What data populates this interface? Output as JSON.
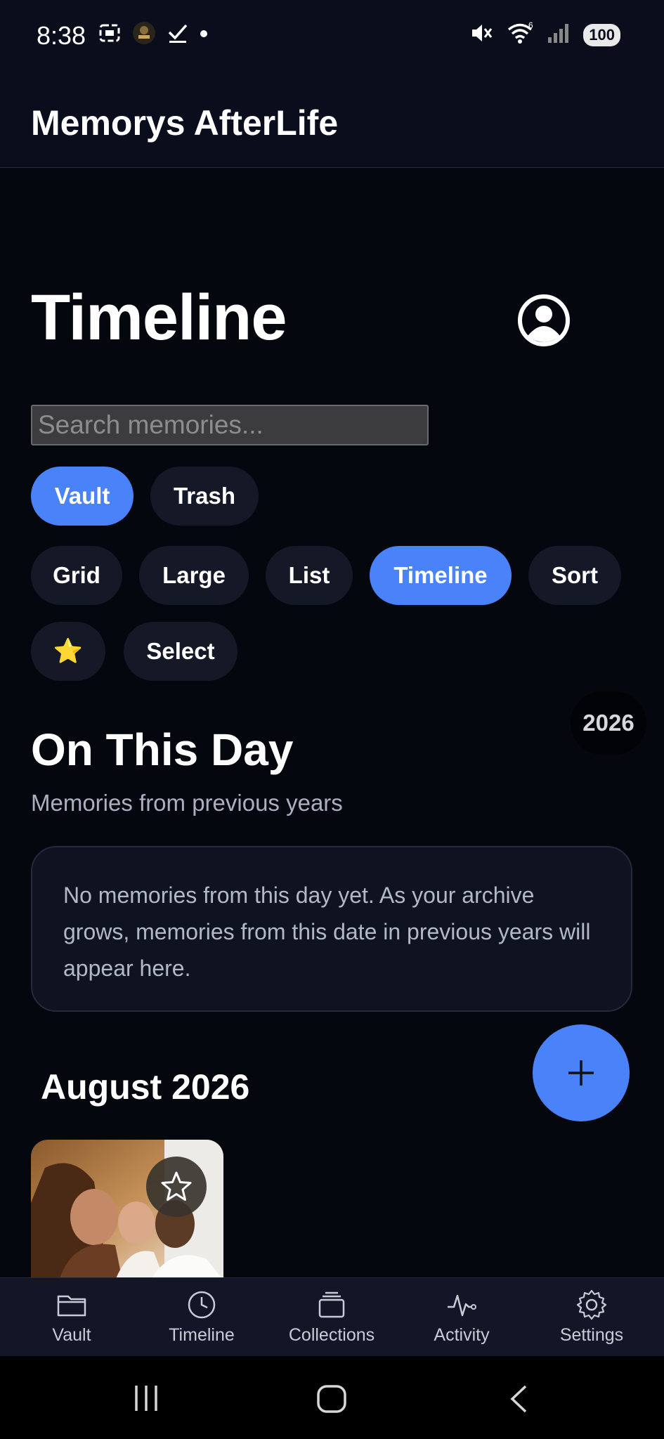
{
  "status_bar": {
    "time": "8:38",
    "battery": "100",
    "left_icons": [
      "screenshot-icon",
      "app-avatar-icon",
      "check-icon",
      "dot-icon"
    ],
    "right_icons": [
      "mute-icon",
      "wifi-icon",
      "signal-icon",
      "battery-icon"
    ],
    "wifi_badge": "6"
  },
  "app": {
    "title": "Memorys AfterLife"
  },
  "page": {
    "title": "Timeline",
    "search_placeholder": "Search memories...",
    "filter_tabs": [
      {
        "label": "Vault",
        "active": true
      },
      {
        "label": "Trash",
        "active": false
      }
    ],
    "view_modes": [
      {
        "label": "Grid",
        "active": false
      },
      {
        "label": "Large",
        "active": false
      },
      {
        "label": "List",
        "active": false
      },
      {
        "label": "Timeline",
        "active": true
      },
      {
        "label": "Sort",
        "active": false
      }
    ],
    "favorites_label": "⭐",
    "select_label": "Select",
    "year_badge": "2026"
  },
  "on_this_day": {
    "title": "On This Day",
    "subtitle": "Memories from previous years",
    "empty_message": "No memories from this day yet. As your archive grows, memories from this date in previous years will appear here."
  },
  "month_section": {
    "label": "August 2026"
  },
  "fab": {
    "icon": "plus-icon"
  },
  "bottom_nav": [
    {
      "label": "Vault",
      "icon": "folder-icon"
    },
    {
      "label": "Timeline",
      "icon": "clock-icon"
    },
    {
      "label": "Collections",
      "icon": "collections-icon"
    },
    {
      "label": "Activity",
      "icon": "activity-icon"
    },
    {
      "label": "Settings",
      "icon": "gear-icon"
    }
  ],
  "colors": {
    "accent": "#4a82f9",
    "background": "#05070f",
    "surface": "#151927"
  }
}
